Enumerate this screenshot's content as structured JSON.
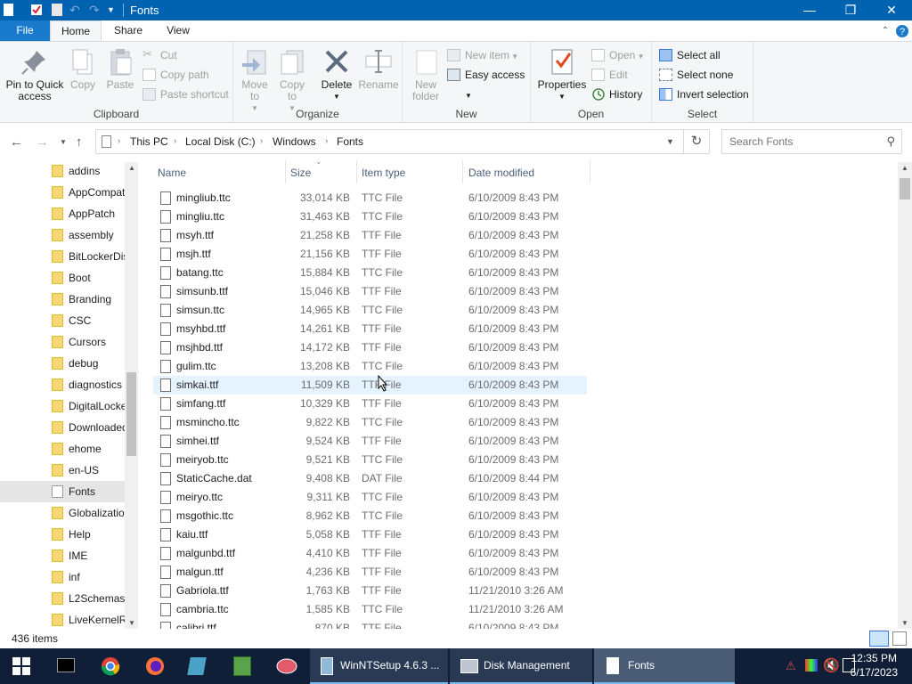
{
  "window": {
    "title": "Fonts"
  },
  "ribbon_tabs": [
    "File",
    "Home",
    "Share",
    "View"
  ],
  "clipboard": {
    "pin_label": "Pin to Quick access",
    "copy_label": "Copy",
    "paste_label": "Paste",
    "cut_label": "Cut",
    "copy_path_label": "Copy path",
    "paste_shortcut_label": "Paste shortcut",
    "group_label": "Clipboard"
  },
  "organize": {
    "move_label": "Move to",
    "copy_label": "Copy to",
    "delete_label": "Delete",
    "rename_label": "Rename",
    "group_label": "Organize"
  },
  "new": {
    "folder_label": "New folder",
    "item_label": "New item",
    "easy_label": "Easy access",
    "group_label": "New"
  },
  "open": {
    "properties_label": "Properties",
    "open_label": "Open",
    "edit_label": "Edit",
    "history_label": "History",
    "group_label": "Open"
  },
  "select": {
    "all_label": "Select all",
    "none_label": "Select none",
    "invert_label": "Invert selection",
    "group_label": "Select"
  },
  "address": {
    "crumbs": [
      "This PC",
      "Local Disk (C:)",
      "Windows",
      "Fonts"
    ]
  },
  "search": {
    "placeholder": "Search Fonts"
  },
  "columns": {
    "name": "Name",
    "size": "Size",
    "type": "Item type",
    "date": "Date modified"
  },
  "nav_items": [
    "addins",
    "AppCompat",
    "AppPatch",
    "assembly",
    "BitLockerDiscoveryVolumeContents",
    "Boot",
    "Branding",
    "CSC",
    "Cursors",
    "debug",
    "diagnostics",
    "DigitalLocker",
    "Downloaded Program Files",
    "ehome",
    "en-US",
    "Fonts",
    "Globalization",
    "Help",
    "IME",
    "inf",
    "L2Schemas",
    "LiveKernelReports"
  ],
  "nav_selected": "Fonts",
  "files": [
    {
      "name": "mingliub.ttc",
      "size": "33,014 KB",
      "type": "TTC File",
      "date": "6/10/2009 8:43 PM"
    },
    {
      "name": "mingliu.ttc",
      "size": "31,463 KB",
      "type": "TTC File",
      "date": "6/10/2009 8:43 PM"
    },
    {
      "name": "msyh.ttf",
      "size": "21,258 KB",
      "type": "TTF File",
      "date": "6/10/2009 8:43 PM"
    },
    {
      "name": "msjh.ttf",
      "size": "21,156 KB",
      "type": "TTF File",
      "date": "6/10/2009 8:43 PM"
    },
    {
      "name": "batang.ttc",
      "size": "15,884 KB",
      "type": "TTC File",
      "date": "6/10/2009 8:43 PM"
    },
    {
      "name": "simsunb.ttf",
      "size": "15,046 KB",
      "type": "TTF File",
      "date": "6/10/2009 8:43 PM"
    },
    {
      "name": "simsun.ttc",
      "size": "14,965 KB",
      "type": "TTC File",
      "date": "6/10/2009 8:43 PM"
    },
    {
      "name": "msyhbd.ttf",
      "size": "14,261 KB",
      "type": "TTF File",
      "date": "6/10/2009 8:43 PM"
    },
    {
      "name": "msjhbd.ttf",
      "size": "14,172 KB",
      "type": "TTF File",
      "date": "6/10/2009 8:43 PM"
    },
    {
      "name": "gulim.ttc",
      "size": "13,208 KB",
      "type": "TTC File",
      "date": "6/10/2009 8:43 PM"
    },
    {
      "name": "simkai.ttf",
      "size": "11,509 KB",
      "type": "TTF File",
      "date": "6/10/2009 8:43 PM"
    },
    {
      "name": "simfang.ttf",
      "size": "10,329 KB",
      "type": "TTF File",
      "date": "6/10/2009 8:43 PM"
    },
    {
      "name": "msmincho.ttc",
      "size": "9,822 KB",
      "type": "TTC File",
      "date": "6/10/2009 8:43 PM"
    },
    {
      "name": "simhei.ttf",
      "size": "9,524 KB",
      "type": "TTF File",
      "date": "6/10/2009 8:43 PM"
    },
    {
      "name": "meiryob.ttc",
      "size": "9,521 KB",
      "type": "TTC File",
      "date": "6/10/2009 8:43 PM"
    },
    {
      "name": "StaticCache.dat",
      "size": "9,408 KB",
      "type": "DAT File",
      "date": "6/10/2009 8:44 PM"
    },
    {
      "name": "meiryo.ttc",
      "size": "9,311 KB",
      "type": "TTC File",
      "date": "6/10/2009 8:43 PM"
    },
    {
      "name": "msgothic.ttc",
      "size": "8,962 KB",
      "type": "TTC File",
      "date": "6/10/2009 8:43 PM"
    },
    {
      "name": "kaiu.ttf",
      "size": "5,058 KB",
      "type": "TTF File",
      "date": "6/10/2009 8:43 PM"
    },
    {
      "name": "malgunbd.ttf",
      "size": "4,410 KB",
      "type": "TTF File",
      "date": "6/10/2009 8:43 PM"
    },
    {
      "name": "malgun.ttf",
      "size": "4,236 KB",
      "type": "TTF File",
      "date": "6/10/2009 8:43 PM"
    },
    {
      "name": "Gabriola.ttf",
      "size": "1,763 KB",
      "type": "TTF File",
      "date": "11/21/2010 3:26 AM"
    },
    {
      "name": "cambria.ttc",
      "size": "1,585 KB",
      "type": "TTC File",
      "date": "11/21/2010 3:26 AM"
    },
    {
      "name": "calibri.ttf",
      "size": "870 KB",
      "type": "TTF File",
      "date": "6/10/2009 8:43 PM"
    }
  ],
  "hovered_row": "simkai.ttf",
  "status": {
    "count": "436 items"
  },
  "taskbar": {
    "apps": [
      "WinNTSetup 4.6.3 ...",
      "Disk Management",
      "Fonts"
    ],
    "active_app": "Fonts",
    "time": "12:35 PM",
    "date": "6/17/2023"
  },
  "colors": {
    "titlebar": "#0063b1",
    "taskbar": "#101f37",
    "file_tab": "#1979ca",
    "hover_row": "#e5f3ff",
    "nav_selected": "#e5e5e5"
  }
}
